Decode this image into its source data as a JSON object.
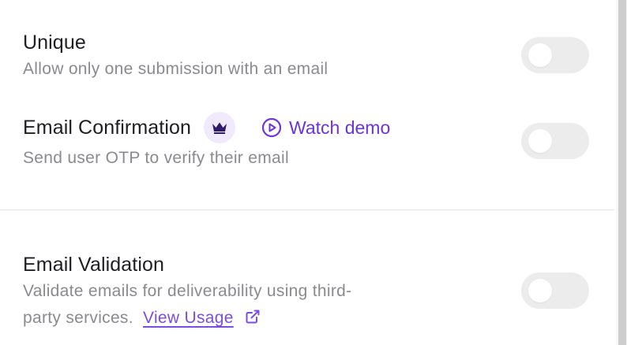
{
  "settings": {
    "unique": {
      "title": "Unique",
      "description": "Allow only one submission with an email",
      "enabled": false
    },
    "email_confirmation": {
      "title": "Email Confirmation",
      "premium_icon": "crown-icon",
      "watch_demo_label": "Watch demo",
      "description": "Send user OTP to verify their email",
      "enabled": false
    },
    "email_validation": {
      "title": "Email Validation",
      "description_line1": "Validate emails for deliverability using third-",
      "description_line2": "party services.",
      "view_usage_label": "View Usage",
      "enabled": false
    }
  },
  "colors": {
    "accent": "#6b35d9",
    "toggle_off": "#ececec",
    "badge_bg": "#f0eafc"
  }
}
